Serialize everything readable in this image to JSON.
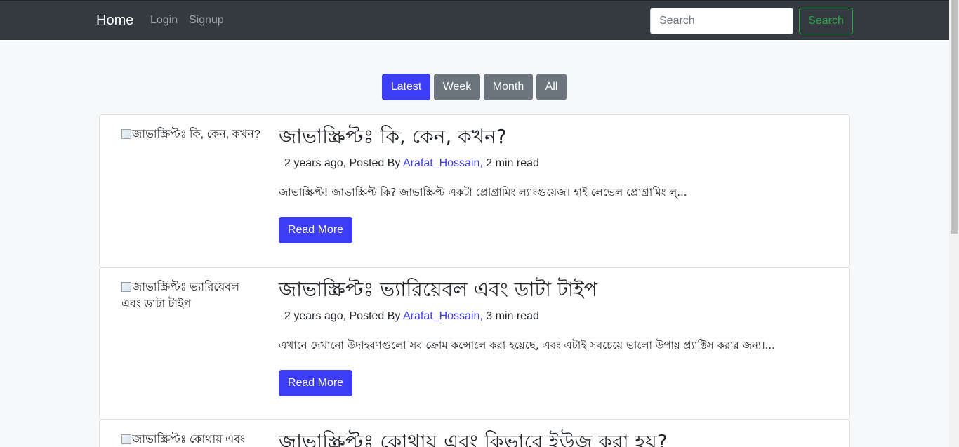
{
  "navbar": {
    "brand": "Home",
    "login": "Login",
    "signup": "Signup",
    "search_placeholder": "Search",
    "search_button": "Search"
  },
  "filters": {
    "latest": "Latest",
    "week": "Week",
    "month": "Month",
    "all": "All"
  },
  "posts": [
    {
      "image_alt": "জাভাস্ক্রিপ্টঃ কি, কেন, কখন?",
      "title": "জাভাস্ক্রিপ্টঃ কি, কেন, কখন?",
      "age": "2 years ago, Posted By",
      "author": "Arafat_Hossain,",
      "read_time": "2 min read",
      "excerpt": "জাভাস্ক্রিপ্ট! জাভাস্ক্রিপ্ট কি? জাভাস্ক্রিপ্ট একটা প্রোগ্রামিং ল্যাংগুয়েজ। হাই লেভেল প্রোগ্রামিং ল্...",
      "read_more": "Read More"
    },
    {
      "image_alt": "জাভাস্ক্রিপ্টঃ ভ্যারিয়েবল এবং ডাটা টাইপ",
      "title": "জাভাস্ক্রিপ্টঃ ভ্যারিয়েবল এবং ডাটা টাইপ",
      "age": "2 years ago, Posted By",
      "author": "Arafat_Hossain,",
      "read_time": "3 min read",
      "excerpt": "এখানে দেখানো উদাহরণগুলো সব ক্রোম কন্সোলে করা হয়েছে, এবং এটাই সবচেয়ে ভালো উপায় প্র্যাক্টিস করার জন্য।...",
      "read_more": "Read More"
    },
    {
      "image_alt": "জাভাস্ক্রিপ্টঃ কোথায় এবং",
      "title": "জাভাস্ক্রিপ্টঃ কোথায় এবং কিভাবে ইউজ করা হয়?"
    }
  ]
}
